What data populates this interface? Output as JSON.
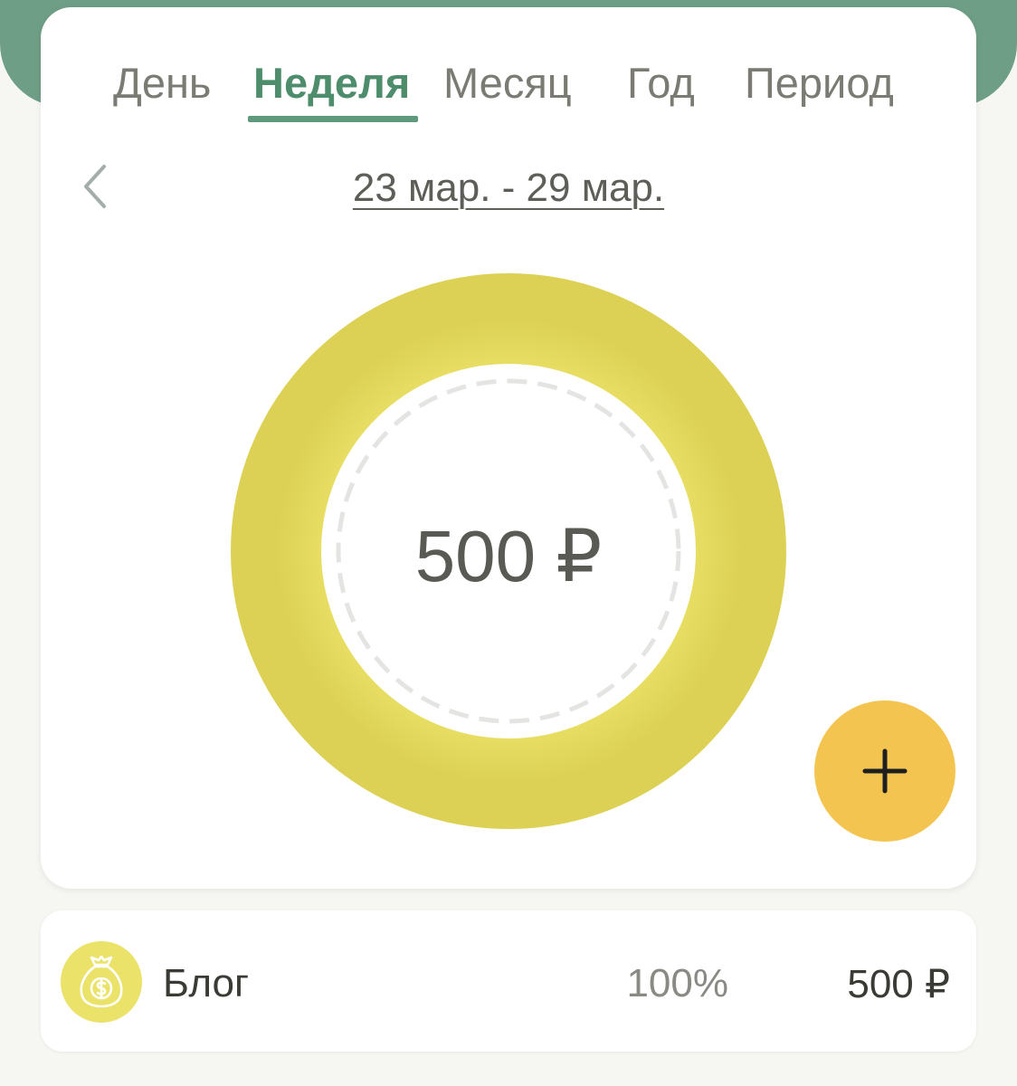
{
  "tabs": {
    "items": [
      {
        "label": "День"
      },
      {
        "label": "Неделя"
      },
      {
        "label": "Месяц"
      },
      {
        "label": "Год"
      },
      {
        "label": "Период"
      }
    ],
    "active": "Неделя"
  },
  "period": {
    "label": "23 мар. - 29 мар."
  },
  "chart": {
    "total": "500 ₽"
  },
  "chart_data": {
    "type": "pie",
    "categories": [
      "Блог"
    ],
    "values": [
      500
    ]
  },
  "categories": [
    {
      "name": "Блог",
      "percent": "100%",
      "amount": "500 ₽",
      "icon": "money-bag-icon"
    }
  ],
  "colors": {
    "header": "#6f9e86",
    "accent": "#4d8d6c",
    "segment": "#e6dc5a",
    "fab": "#f3c44f"
  }
}
